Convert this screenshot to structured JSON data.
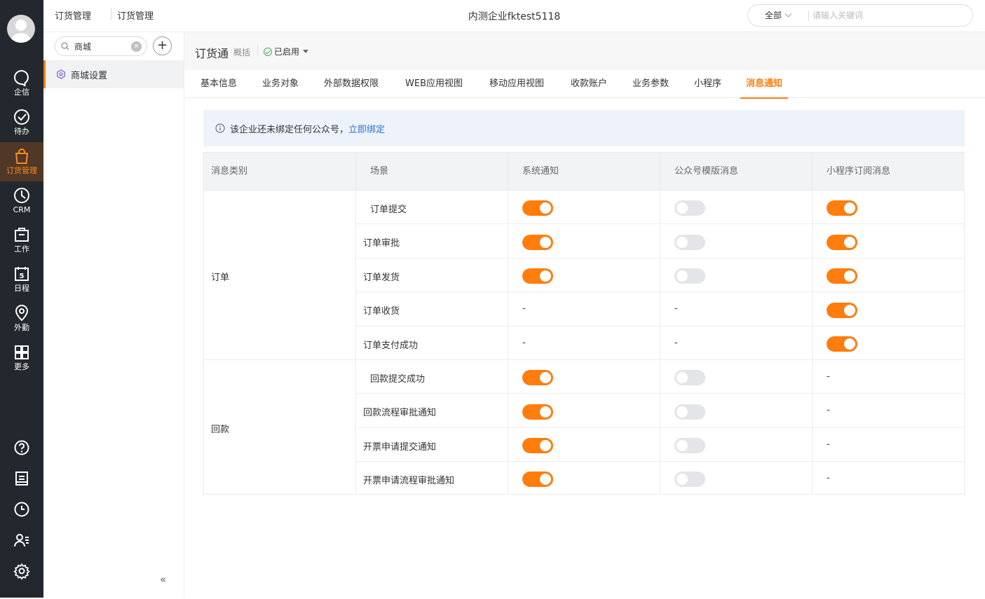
{
  "topbar": {
    "breadcrumb": [
      "订货管理",
      "订货管理"
    ],
    "company": "内测企业fktest5118",
    "search_scope": "全部",
    "search_placeholder": "请输入关键词"
  },
  "rail": {
    "items": [
      {
        "label": "企信",
        "icon": "chat-bubble-icon"
      },
      {
        "label": "待办",
        "icon": "check-circle-icon"
      },
      {
        "label": "订货管理",
        "icon": "shopping-bag-icon",
        "active": true
      },
      {
        "label": "CRM",
        "icon": "clock-pie-icon"
      },
      {
        "label": "工作",
        "icon": "briefcase-icon"
      },
      {
        "label": "日程",
        "icon": "calendar-icon",
        "badge": "5"
      },
      {
        "label": "外勤",
        "icon": "location-pin-icon"
      },
      {
        "label": "更多",
        "icon": "grid-icon"
      }
    ],
    "tools": [
      "help-icon",
      "notebook-icon",
      "history-clock-icon",
      "contacts-icon",
      "settings-gear-icon"
    ]
  },
  "sidebar": {
    "search_value": "商城",
    "items": [
      {
        "label": "商城设置",
        "icon": "settings-hex-icon"
      }
    ],
    "collapse_label": "«"
  },
  "main": {
    "title": "订货通",
    "subtitle": "概括",
    "status": "已启用",
    "tabs": [
      "基本信息",
      "业务对象",
      "外部数据权限",
      "WEB应用视图",
      "移动应用视图",
      "收款账户",
      "业务参数",
      "小程序",
      "消息通知"
    ],
    "active_tab": "消息通知",
    "notice": {
      "text": "该企业还未绑定任何公众号，",
      "link": "立即绑定"
    },
    "table": {
      "headers": [
        "消息类别",
        "场景",
        "系统通知",
        "公众号模版消息",
        "小程序订阅消息"
      ],
      "groups": [
        {
          "category": "订单",
          "rows": [
            {
              "scene": "订单提交",
              "system": true,
              "mp": false,
              "mini": true
            },
            {
              "scene": "订单审批",
              "system": true,
              "mp": false,
              "mini": true
            },
            {
              "scene": "订单发货",
              "system": true,
              "mp": false,
              "mini": true
            },
            {
              "scene": "订单收货",
              "system": null,
              "mp": null,
              "mini": true
            },
            {
              "scene": "订单支付成功",
              "system": null,
              "mp": null,
              "mini": true
            }
          ]
        },
        {
          "category": "回款",
          "rows": [
            {
              "scene": "回款提交成功",
              "system": true,
              "mp": false,
              "mini": null
            },
            {
              "scene": "回款流程审批通知",
              "system": true,
              "mp": false,
              "mini": null
            },
            {
              "scene": "开票申请提交通知",
              "system": true,
              "mp": false,
              "mini": null
            },
            {
              "scene": "开票申请流程审批通知",
              "system": true,
              "mp": false,
              "mini": null
            }
          ]
        }
      ],
      "empty_mark": "-"
    },
    "colors": {
      "accent": "#ff7d0c",
      "switch_off": "#e4e5e9",
      "link": "#2f6fd6",
      "rail_bg": "#23272e"
    }
  }
}
